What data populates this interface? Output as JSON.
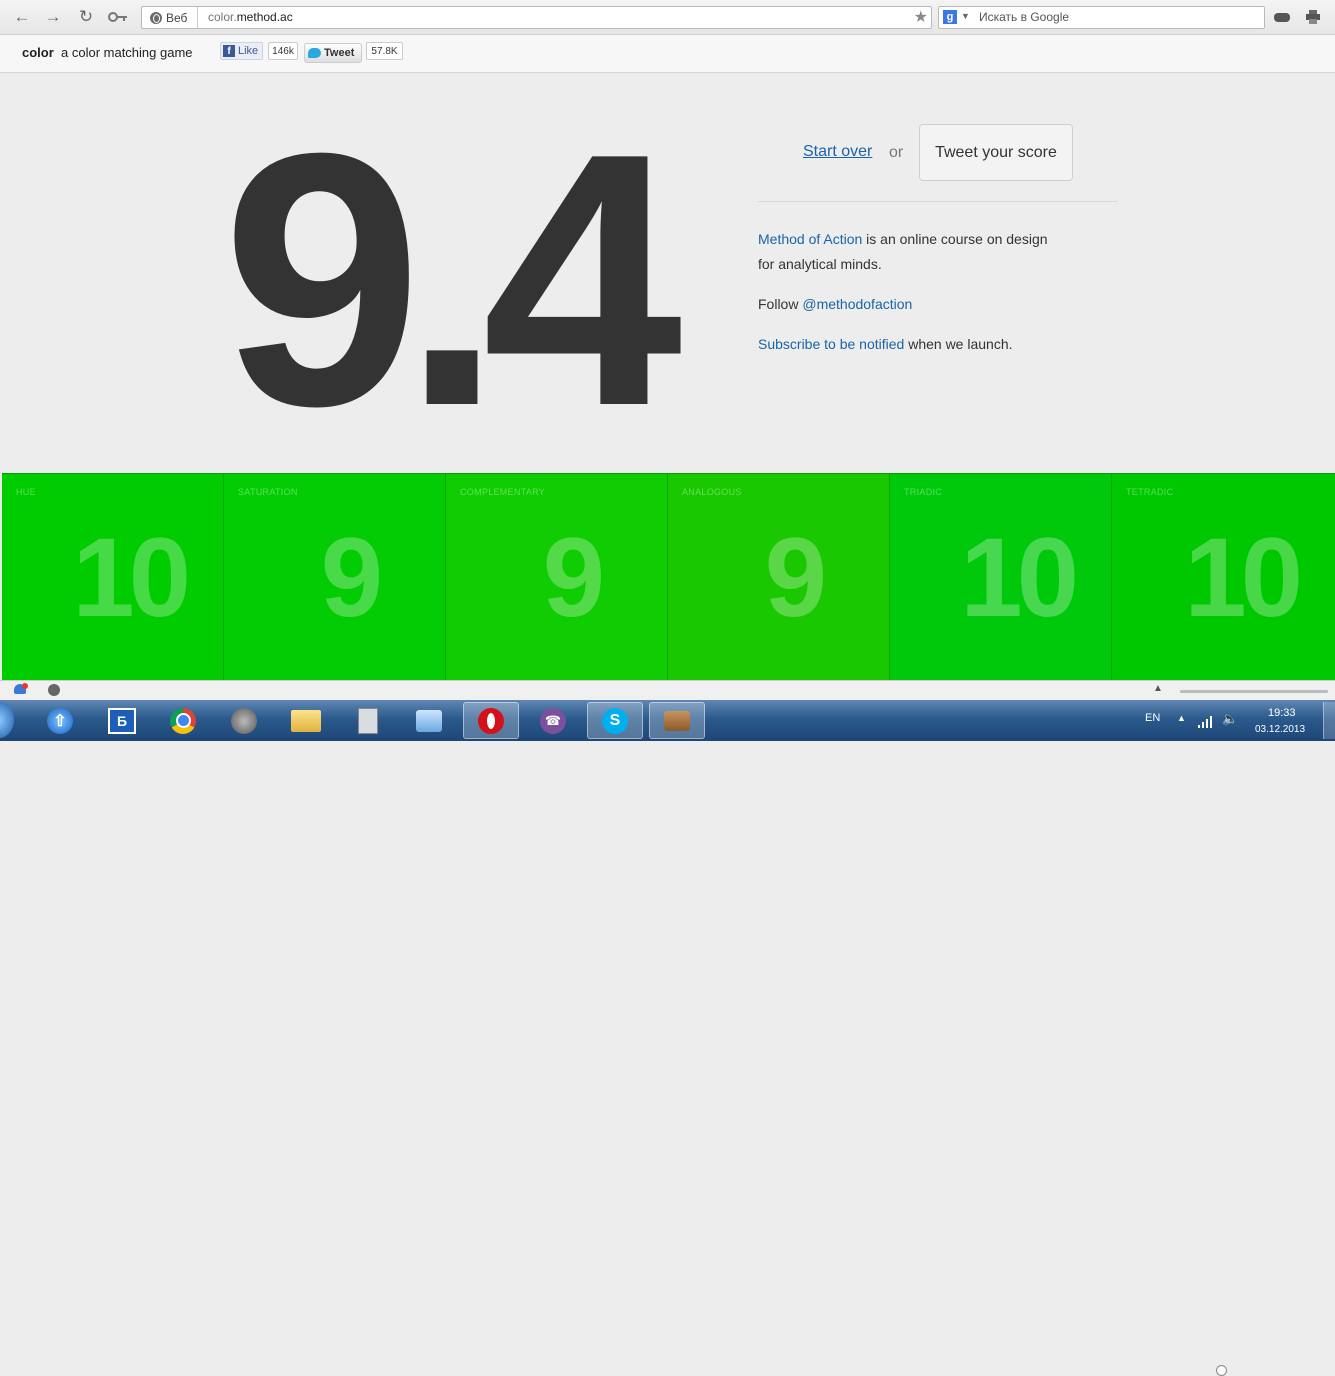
{
  "browser": {
    "site_chip": "Веб",
    "url_prefix": "color.",
    "url_domain": "method.ac",
    "search_placeholder": "Искать в Google",
    "search_badge": "g"
  },
  "header": {
    "brand": "color",
    "tagline": "a color matching game",
    "fb_like": "Like",
    "fb_f": "f",
    "fb_count": "146k",
    "tweet_label": "Tweet",
    "tweet_count": "57.8K"
  },
  "main": {
    "score": "9.4",
    "start_over": "Start over",
    "or": "or",
    "tweet_score": "Tweet your score",
    "about_link": "Method of Action",
    "about_text_1": " is an online course on design",
    "about_text_2": "for analytical minds.",
    "follow_prefix": "Follow ",
    "follow_handle": "@methodofaction",
    "subscribe_link": "Subscribe to be notified",
    "subscribe_suffix": " when we launch."
  },
  "tiles": [
    {
      "label": "HUE",
      "value": "10",
      "color": "#00cc00"
    },
    {
      "label": "SATURATION",
      "value": "9",
      "color": "#04cc04"
    },
    {
      "label": "COMPLEMENTARY",
      "value": "9",
      "color": "#10cc02"
    },
    {
      "label": "ANALOGOUS",
      "value": "9",
      "color": "#1ac800"
    },
    {
      "label": "TRIADIC",
      "value": "10",
      "color": "#00c90c"
    },
    {
      "label": "TETRADIC",
      "value": "10",
      "color": "#00c800"
    }
  ],
  "taskbar": {
    "lang": "EN",
    "time": "19:33",
    "date": "03.12.2013",
    "apps": [
      "start",
      "upload",
      "bdb",
      "chrome",
      "gear",
      "explorer",
      "calculator",
      "mail",
      "opera",
      "viber",
      "skype",
      "wallet"
    ]
  },
  "colors": {
    "score": "#333333",
    "link": "#1b63a8",
    "tile_green": "#00cc00"
  }
}
